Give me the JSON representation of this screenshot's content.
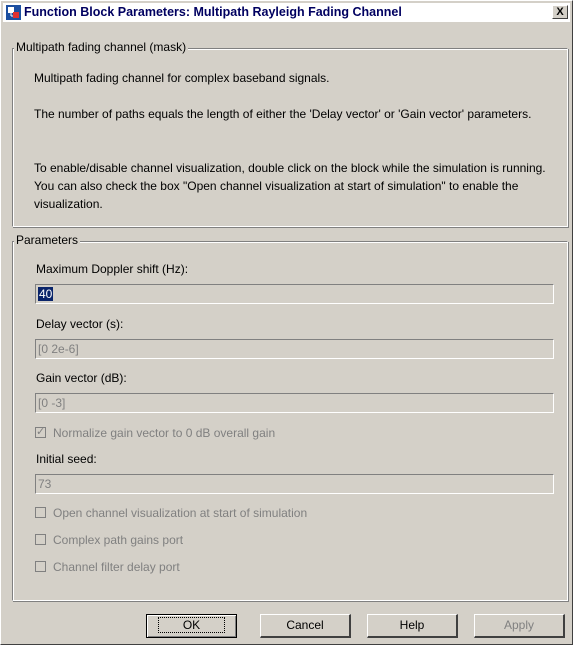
{
  "window": {
    "title": "Function Block Parameters: Multipath Rayleigh Fading Channel",
    "close_label": "X"
  },
  "mask_group": {
    "legend": "Multipath fading channel (mask)",
    "para1": "Multipath fading channel for complex baseband signals.",
    "para2": "The number of paths equals the length of either the 'Delay vector' or 'Gain vector' parameters.",
    "para3": "To enable/disable channel visualization, double click on the block while the simulation is running.  You can also check the box \"Open channel visualization at start of simulation\" to enable the visualization."
  },
  "params_group": {
    "legend": "Parameters",
    "doppler_label": "Maximum Doppler shift (Hz):",
    "doppler_value": "40",
    "delay_label": "Delay vector (s):",
    "delay_value": "[0 2e-6]",
    "gain_label": "Gain vector (dB):",
    "gain_value": "[0 -3]",
    "normalize_label": "Normalize gain vector to 0 dB overall gain",
    "normalize_checked": true,
    "seed_label": "Initial seed:",
    "seed_value": "73",
    "open_vis_label": "Open channel visualization at start of simulation",
    "open_vis_checked": false,
    "complex_gain_label": "Complex path gains port",
    "complex_gain_checked": false,
    "filter_delay_label": "Channel filter delay port",
    "filter_delay_checked": false
  },
  "buttons": {
    "ok": "OK",
    "cancel": "Cancel",
    "help": "Help",
    "apply": "Apply"
  },
  "icons": {
    "app": "simulink-block-icon",
    "close": "close-icon"
  }
}
